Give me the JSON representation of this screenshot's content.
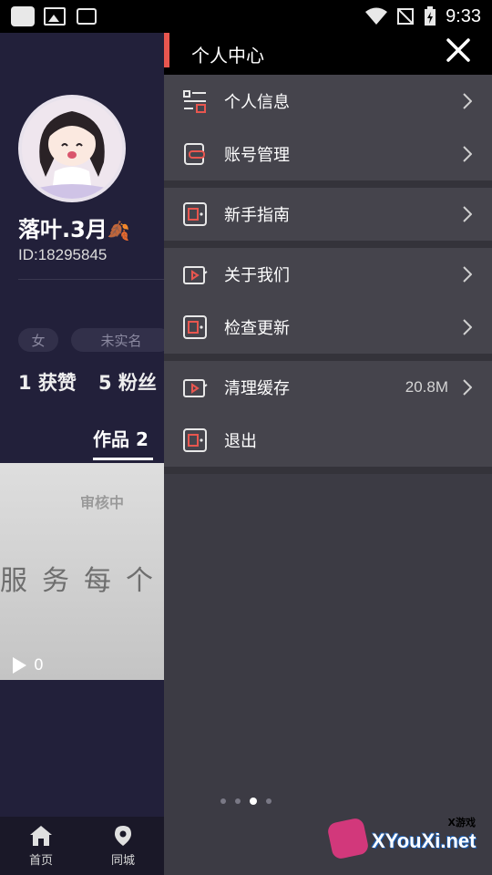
{
  "status_bar": {
    "time": "9:33"
  },
  "profile": {
    "nickname": "落叶.3月",
    "id_text": "ID:18295845",
    "gender_tag": "女",
    "verify_tag": "未实名",
    "likes": "1 获赞",
    "fans": "5 粉丝",
    "works_tab": "作品 2"
  },
  "thumbnail": {
    "status": "审核中",
    "overlay_text": "服务每个",
    "play_count": "0"
  },
  "bottom_nav": [
    {
      "label": "首页",
      "icon": "home-icon"
    },
    {
      "label": "同城",
      "icon": "location-icon"
    }
  ],
  "drawer": {
    "title": "个人中心",
    "groups": [
      [
        {
          "label": "个人信息",
          "icon": "profile-info-icon",
          "value": ""
        },
        {
          "label": "账号管理",
          "icon": "account-icon",
          "value": ""
        }
      ],
      [
        {
          "label": "新手指南",
          "icon": "guide-icon",
          "value": ""
        }
      ],
      [
        {
          "label": "关于我们",
          "icon": "about-icon",
          "value": ""
        },
        {
          "label": "检查更新",
          "icon": "update-icon",
          "value": ""
        }
      ],
      [
        {
          "label": "清理缓存",
          "icon": "cache-icon",
          "value": "20.8M"
        },
        {
          "label": "退出",
          "icon": "logout-icon",
          "value": ""
        }
      ]
    ],
    "pager_active": 3,
    "pager_count": 4
  },
  "watermark": {
    "top_text": "X游戏",
    "brand": "XYouXi.net"
  },
  "colors": {
    "accent": "#e8564f",
    "drawer_bg": "#3c3b44",
    "group_bg": "#45444c"
  }
}
